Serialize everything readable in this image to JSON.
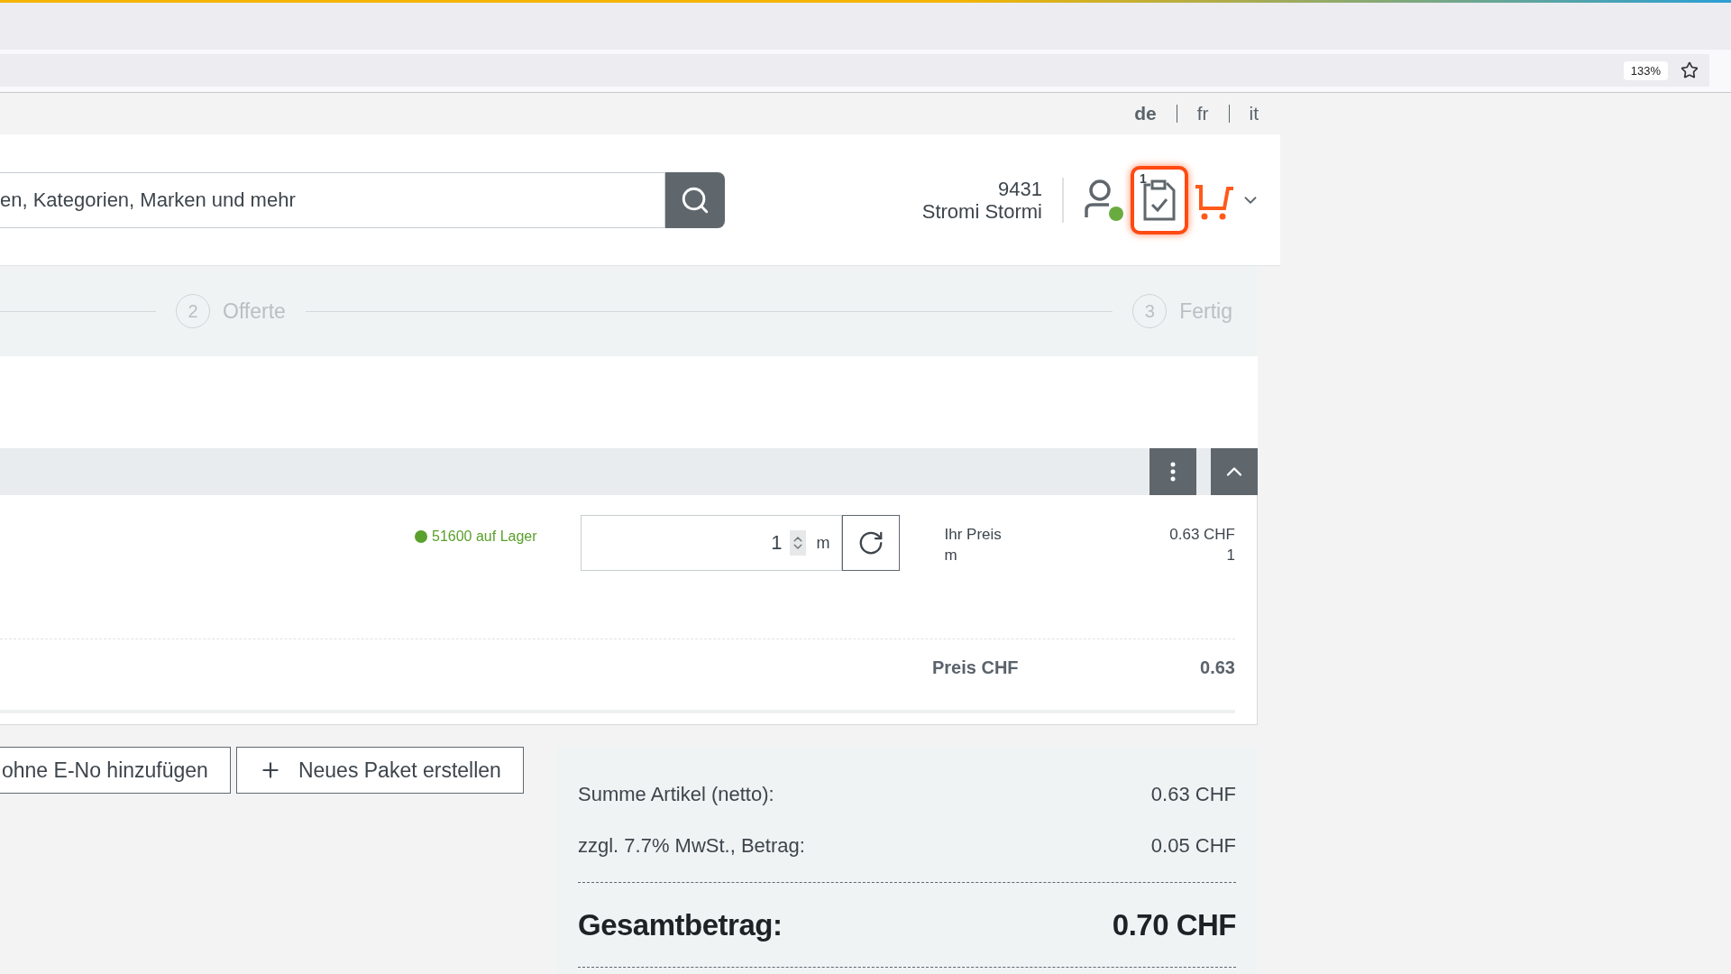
{
  "browser": {
    "zoom": "133%"
  },
  "languages": [
    {
      "label": "de",
      "selected": true
    },
    {
      "label": "fr",
      "selected": false
    },
    {
      "label": "it",
      "selected": false
    }
  ],
  "search": {
    "placeholder": "en, Kategorien, Marken und mehr"
  },
  "user": {
    "number": "9431",
    "name": "Stromi Stormi",
    "online": true
  },
  "order_list": {
    "count": "1",
    "highlighted": true
  },
  "steps": [
    {
      "number": "2",
      "label": "Offerte"
    },
    {
      "number": "3",
      "label": "Fertig"
    }
  ],
  "product": {
    "stock": "51600 auf Lager",
    "in_stock": true,
    "quantity": "1",
    "unit": "m",
    "price_label": "Ihr Preis",
    "price_unit": "m",
    "price": "0.63 CHF",
    "price_quantity": "1",
    "total_label": "Preis CHF",
    "total": "0.63"
  },
  "actions": [
    {
      "kind": "plain",
      "label": "ohne E-No hinzufügen"
    },
    {
      "kind": "add",
      "label": "Neues Paket erstellen"
    }
  ],
  "summary": {
    "rows": [
      {
        "label": "Summe Artikel (netto):",
        "value": "0.63 CHF"
      },
      {
        "label": "zzgl. 7.7% MwSt., Betrag:",
        "value": "0.05 CHF"
      }
    ],
    "total": {
      "label": "Gesamtbetrag:",
      "value": "0.70 CHF"
    }
  }
}
